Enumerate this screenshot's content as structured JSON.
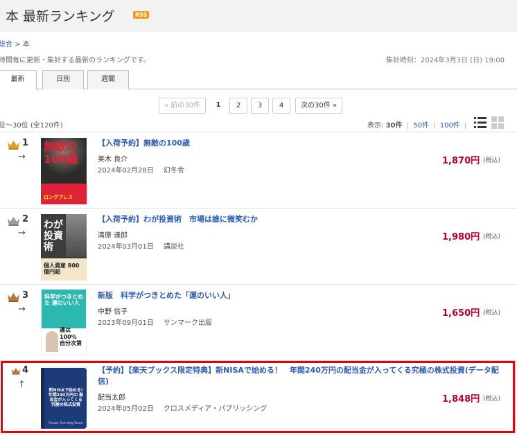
{
  "header": {
    "title": "本 最新ランキング",
    "rss": "RSS"
  },
  "breadcrumb": {
    "root": "総合",
    "sep": ">",
    "current": "本"
  },
  "description": "時間毎に更新・集計する最新のランキングです。",
  "aggregate": "集計時刻：2024年3月3日 (日) 19:00",
  "tabs": [
    {
      "label": "最新"
    },
    {
      "label": "日別"
    },
    {
      "label": "週間"
    }
  ],
  "pagination": {
    "prev": "« 前の30件",
    "pages": [
      "1",
      "2",
      "3",
      "4"
    ],
    "current": "1",
    "next": "次の30件 »"
  },
  "range": "位～30位 (全120件)",
  "display": {
    "label": "表示:",
    "options": [
      "30件",
      "50件",
      "100件"
    ],
    "selected": "30件",
    "sep": "|"
  },
  "colors": {
    "link": "#2a5bb5",
    "price": "#b7002a",
    "highlight": "#e5000a",
    "gold": "#d9a32b",
    "silver": "#9a9a9a",
    "bronze": "#b87a3d"
  },
  "items": [
    {
      "rank": "1",
      "trend": "→",
      "crown": "gold",
      "title": "【入荷予約】無敵の100歳",
      "author": "美木 良介",
      "date": "2024年02月28日",
      "publisher": "幻冬舎",
      "price": "1,870円",
      "tax": "(税込)",
      "cover": {
        "text": "無敵の100歳",
        "sub": "ロングブレス",
        "bg": "#2b2b2b",
        "accent": "#e0213a"
      }
    },
    {
      "rank": "2",
      "trend": "→",
      "crown": "silver",
      "title": "【入荷予約】わが投資術　市場は誰に微笑むか",
      "author": "清原 達郎",
      "date": "2024年03月01日",
      "publisher": "講談社",
      "price": "1,980円",
      "tax": "(税込)",
      "cover": {
        "text": "わが投資術",
        "sub": "個人資産 800億円超",
        "bg": "#3c3c3c",
        "accent": "#f2e6c8"
      }
    },
    {
      "rank": "3",
      "trend": "→",
      "crown": "bronze",
      "title": "新版　科学がつきとめた「運のいい人」",
      "author": "中野 信子",
      "date": "2023年09月01日",
      "publisher": "サンマーク出版",
      "price": "1,650円",
      "tax": "(税込)",
      "cover": {
        "text": "科学がつきとめた 運のいい人",
        "sub": "運は100% 自分次第",
        "bg": "#2bb8b0",
        "accent": "#ffffff"
      }
    },
    {
      "rank": "4",
      "trend": "↑",
      "crown": "bronze",
      "title": "【予約】【楽天ブックス限定特典】新NISAで始める！　年間240万円の配当金が入ってくる究極の株式投資(データ配信)",
      "title_line2": "配信)",
      "author": "配当太郎",
      "date": "2024年05月02日",
      "publisher": "クロスメディア・パブリッシング",
      "price": "1,848円",
      "tax": "(税込)",
      "cover": {
        "text": "新NISAで始める! 年間240万円の 配当金が入ってくる 究極の株式投資",
        "sub": "Cover Coming Soon",
        "bg": "#1d3a7a",
        "accent": "#ffffff"
      }
    }
  ]
}
